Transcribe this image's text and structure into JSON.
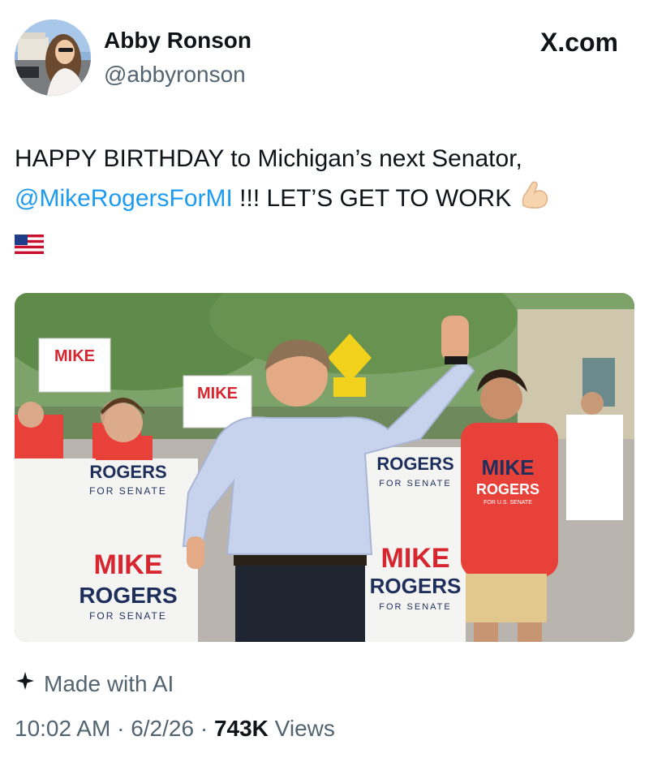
{
  "author": {
    "display_name": "Abby Ronson",
    "handle": "@abbyronson",
    "avatar_icon": "profile-photo"
  },
  "site_logo": "X.com",
  "tweet": {
    "text_part1": "HAPPY BIRTHDAY to Michigan’s next Senator,",
    "mention": "@MikeRogersForMI",
    "text_part2": " !!! LET’S GET TO WORK ",
    "emoji_1": "flexed-biceps-emoji",
    "emoji_2": "us-flag-emoji"
  },
  "photo": {
    "signs": {
      "mike": "MIKE",
      "rogers": "ROGERS",
      "rogers_left": "R",
      "rogers_right": "GERS",
      "for_senate": "FOR SENATE",
      "for_us_senate": "FOR U.S. SENATE"
    },
    "colors": {
      "sign_red": "#d7262f",
      "sign_navy": "#1f2f5c",
      "shirt_red": "#e8413a",
      "dress_shirt": "#c7d2ec"
    }
  },
  "ai_label": "Made with AI",
  "meta": {
    "time": "10:02 AM",
    "date": "6/2/26",
    "views_count": "743K",
    "views_label": "Views",
    "separator": "·"
  }
}
